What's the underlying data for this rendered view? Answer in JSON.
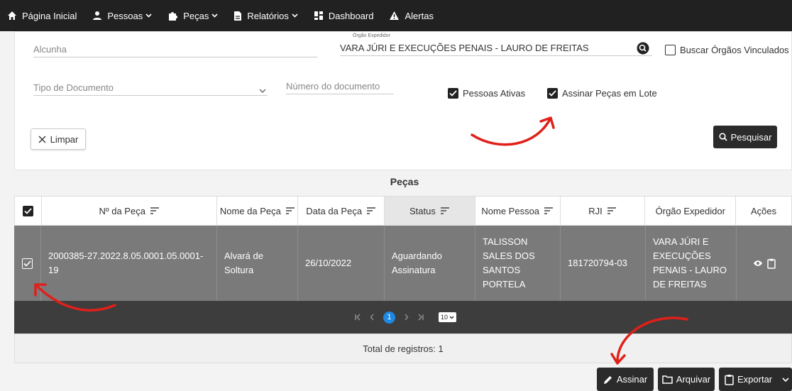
{
  "nav": {
    "items": [
      {
        "label": "Página Inicial",
        "icon": "home-icon"
      },
      {
        "label": "Pessoas",
        "icon": "person-icon"
      },
      {
        "label": "Peças",
        "icon": "puzzle-icon"
      },
      {
        "label": "Relatórios",
        "icon": "document-icon"
      },
      {
        "label": "Dashboard",
        "icon": "dashboard-icon"
      },
      {
        "label": "Alertas",
        "icon": "warning-icon"
      }
    ]
  },
  "filters": {
    "alcunha_placeholder": "Alcunha",
    "orgao_label": "Órgão Expedidor",
    "orgao_value": "VARA JÚRI E EXECUÇÕES PENAIS - LAURO DE FREITAS",
    "buscar_vinculados": "Buscar Órgãos Vinculados",
    "tipo_documento_placeholder": "Tipo de Documento",
    "numero_documento_placeholder": "Número do documento",
    "pessoas_ativas": "Pessoas Ativas",
    "assinar_lote": "Assinar Peças em Lote",
    "limpar": "Limpar",
    "pesquisar": "Pesquisar"
  },
  "table": {
    "title": "Peças",
    "columns": [
      "Nº da Peça",
      "Nome da Peça",
      "Data da Peça",
      "Status",
      "Nome Pessoa",
      "RJI",
      "Órgão Expedidor",
      "Ações"
    ],
    "rows": [
      {
        "numero": "2000385-27.2022.8.05.0001.05.0001-19",
        "nome": "Alvará de Soltura",
        "data": "26/10/2022",
        "status": "Aguardando Assinatura",
        "pessoa": "TALISSON SALES DOS SANTOS PORTELA",
        "rji": "181720794-03",
        "orgao": "VARA JÚRI E EXECUÇÕES PENAIS - LAURO DE FREITAS"
      }
    ],
    "pagination": {
      "current": "1",
      "page_size": "10"
    },
    "total": "Total de registros: 1"
  },
  "actions": {
    "assinar": "Assinar",
    "arquivar": "Arquivar",
    "exportar": "Exportar"
  },
  "colors": {
    "nav_bg": "#212121",
    "row_selected": "#7a7a7a",
    "pager_bg": "#3d3d3d",
    "annotation_red": "#e0201a",
    "page_active": "#1e88e5"
  }
}
